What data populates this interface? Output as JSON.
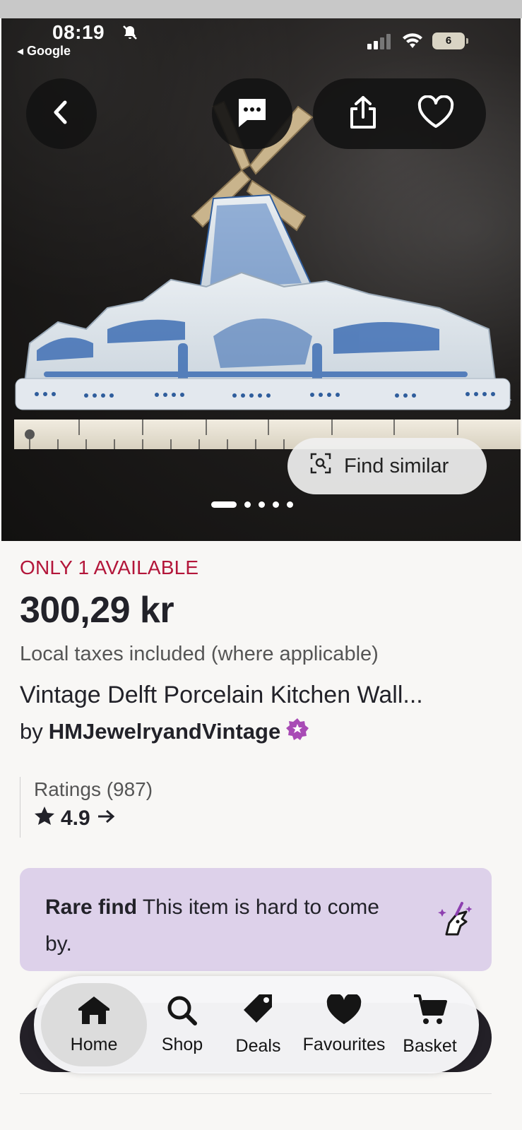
{
  "status_bar": {
    "time": "08:19",
    "back_app": "Google",
    "battery": "6"
  },
  "image_carousel": {
    "find_similar_label": "Find similar",
    "page_count": 5,
    "active_page": 1
  },
  "listing": {
    "availability": "ONLY 1 AVAILABLE",
    "price": "300,29 kr",
    "taxes_note": "Local taxes included (where applicable)",
    "title": "Vintage Delft Porcelain Kitchen Wall...",
    "seller_prefix": "by",
    "seller_name": "HMJewelryandVintage",
    "ratings_label": "Ratings (987)",
    "rating_value": "4.9"
  },
  "rare_find": {
    "bold": "Rare find",
    "text": "This item is hard to come by."
  },
  "bottom_nav": {
    "items": [
      {
        "label": "Home",
        "icon": "home-icon",
        "active": true
      },
      {
        "label": "Shop",
        "icon": "search-icon",
        "active": false
      },
      {
        "label": "Deals",
        "icon": "tag-icon",
        "active": false
      },
      {
        "label": "Favourites",
        "icon": "heart-icon",
        "active": false
      },
      {
        "label": "Basket",
        "icon": "cart-icon",
        "active": false
      }
    ]
  },
  "colors": {
    "availability_red": "#b3163a",
    "rare_find_bg": "#ddd1ea",
    "star_seller_badge": "#a84bb5"
  }
}
